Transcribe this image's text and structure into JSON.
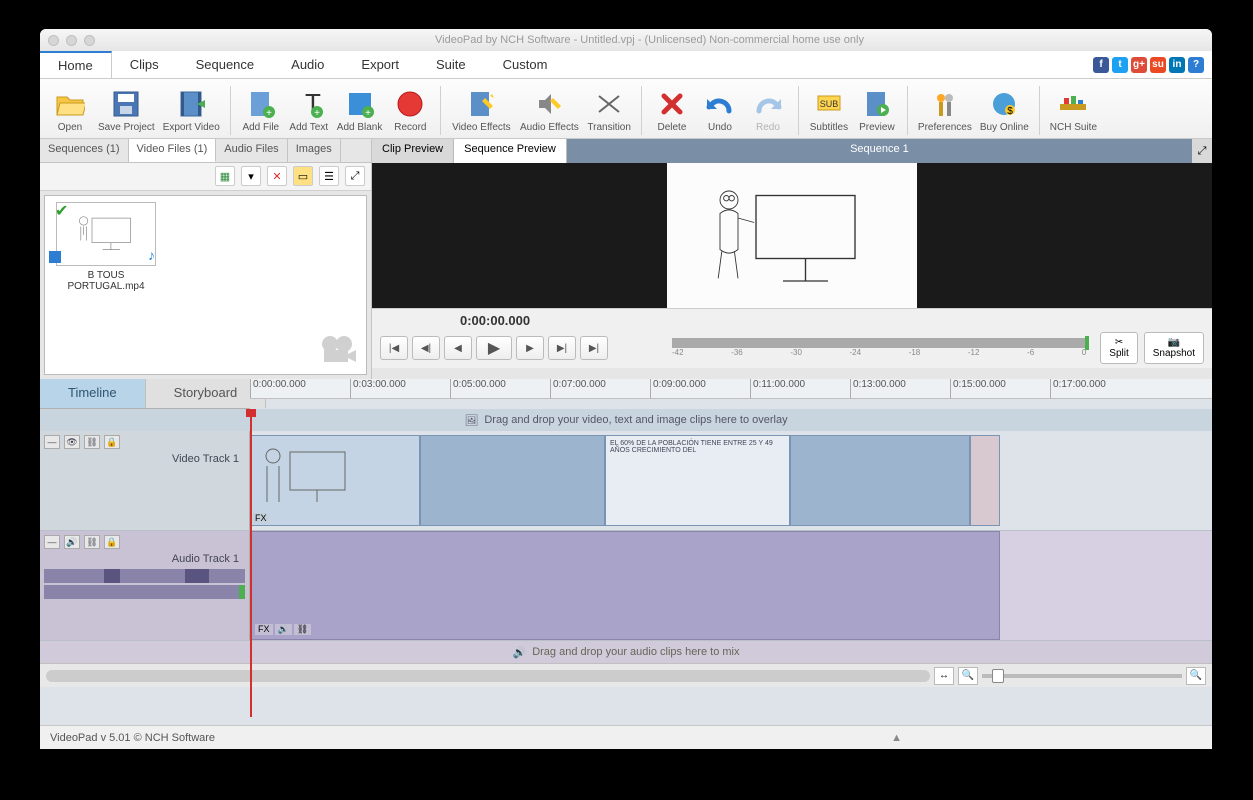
{
  "window": {
    "title": "VideoPad by NCH Software - Untitled.vpj - (Unlicensed) Non-commercial home use only"
  },
  "menu": {
    "items": [
      "Home",
      "Clips",
      "Sequence",
      "Audio",
      "Export",
      "Suite",
      "Custom"
    ],
    "active": "Home"
  },
  "toolbar": {
    "open": "Open",
    "save": "Save Project",
    "export": "Export Video",
    "addfile": "Add File",
    "addtext": "Add Text",
    "addblank": "Add Blank",
    "record": "Record",
    "vfx": "Video Effects",
    "afx": "Audio Effects",
    "transition": "Transition",
    "delete": "Delete",
    "undo": "Undo",
    "redo": "Redo",
    "subtitles": "Subtitles",
    "preview": "Preview",
    "prefs": "Preferences",
    "buy": "Buy Online",
    "suite": "NCH Suite"
  },
  "bin": {
    "tabs": {
      "sequences": "Sequences (1)",
      "video": "Video Files (1)",
      "audio": "Audio Files",
      "images": "Images"
    },
    "active": "video",
    "clip": {
      "name": "B TOUS PORTUGAL.mp4"
    }
  },
  "preview": {
    "tabs": {
      "clip": "Clip Preview",
      "seq": "Sequence Preview"
    },
    "active": "seq",
    "seq_name": "Sequence 1",
    "timecode": "0:00:00.000",
    "meter_ticks": [
      "-42",
      "-36",
      "-30",
      "-24",
      "-18",
      "-12",
      "-6",
      "0"
    ],
    "split": "Split",
    "snapshot": "Snapshot"
  },
  "timeline": {
    "tabs": {
      "timeline": "Timeline",
      "storyboard": "Storyboard"
    },
    "active": "timeline",
    "ruler": [
      "0:00:00.000",
      "0:03:00.000",
      "0:05:00.000",
      "0:07:00.000",
      "0:09:00.000",
      "0:11:00.000",
      "0:13:00.000",
      "0:15:00.000",
      "0:17:00.000"
    ],
    "overlay_hint": "Drag and drop your video, text and image clips here to overlay",
    "video_track": "Video Track 1",
    "audio_track": "Audio Track 1",
    "audio_hint": "Drag and drop your audio clips here to mix",
    "clip_text": "EL 60% DE LA POBLACIÓN TIENE ENTRE 25 Y 49 AÑOS CRECIMIENTO DEL"
  },
  "status": "VideoPad v 5.01 © NCH Software"
}
